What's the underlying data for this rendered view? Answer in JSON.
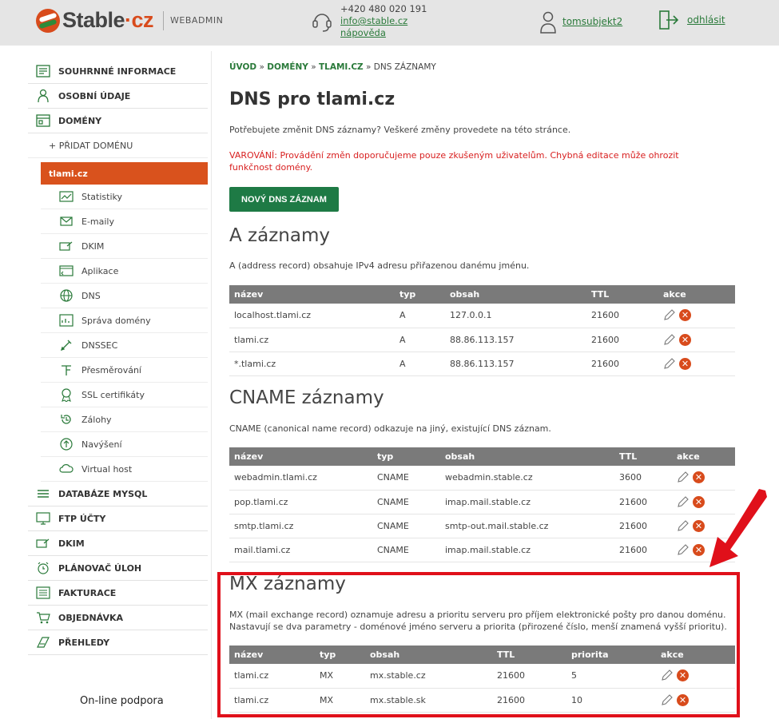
{
  "header": {
    "logo_text": "Stable",
    "logo_dot": "·cz",
    "logo_sub": "WEBADMIN",
    "phone": "+420 480 020 191",
    "email": "info@stable.cz",
    "help": "nápověda",
    "username": "tomsubjekt2",
    "logout": "odhlásit"
  },
  "sidebar": {
    "items_top": [
      {
        "label": "SOUHRNNÉ INFORMACE",
        "icon": "summary-icon"
      },
      {
        "label": "OSOBNÍ ÚDAJE",
        "icon": "person-icon"
      },
      {
        "label": "DOMÉNY",
        "icon": "domains-icon"
      }
    ],
    "add_domain": "+ PŘIDAT DOMÉNU",
    "active_domain": "tlami.cz",
    "sub_items": [
      {
        "label": "Statistiky",
        "icon": "stats-icon"
      },
      {
        "label": "E-maily",
        "icon": "email-icon"
      },
      {
        "label": "DKIM",
        "icon": "dkim-icon"
      },
      {
        "label": "Aplikace",
        "icon": "apps-icon"
      },
      {
        "label": "DNS",
        "icon": "globe-icon"
      },
      {
        "label": "Správa domény",
        "icon": "domain-manage-icon"
      },
      {
        "label": "DNSSEC",
        "icon": "dnssec-icon"
      },
      {
        "label": "Přesměrování",
        "icon": "redirect-icon"
      },
      {
        "label": "SSL certifikáty",
        "icon": "ssl-icon"
      },
      {
        "label": "Zálohy",
        "icon": "backup-icon"
      },
      {
        "label": "Navýšení",
        "icon": "upgrade-icon"
      },
      {
        "label": "Virtual host",
        "icon": "cloud-icon"
      }
    ],
    "items_bottom": [
      {
        "label": "DATABÁZE MYSQL",
        "icon": "database-icon"
      },
      {
        "label": "FTP ÚČTY",
        "icon": "ftp-icon"
      },
      {
        "label": "DKIM",
        "icon": "dkim-icon"
      },
      {
        "label": "PLÁNOVAČ ÚLOH",
        "icon": "alarm-icon"
      },
      {
        "label": "FAKTURACE",
        "icon": "invoice-icon"
      },
      {
        "label": "OBJEDNÁVKA",
        "icon": "cart-icon"
      },
      {
        "label": "PŘEHLEDY",
        "icon": "overview-icon"
      }
    ],
    "support": "On-line podpora"
  },
  "breadcrumb": {
    "home": "ÚVOD",
    "domains": "DOMÉNY",
    "domain": "TLAMI.CZ",
    "current": "DNS ZÁZNAMY"
  },
  "main": {
    "title": "DNS pro tlami.cz",
    "intro": "Potřebujete změnit DNS záznamy? Veškeré změny provedete na této stránce.",
    "warning": "VAROVÁNÍ: Provádění změn doporučujeme pouze zkušeným uživatelům. Chybná editace může ohrozit funkčnost domény.",
    "new_button": "NOVÝ DNS ZÁZNAM"
  },
  "a_section": {
    "title": "A záznamy",
    "desc": "A (address record) obsahuje IPv4 adresu přiřazenou danému jménu.",
    "headers": [
      "název",
      "typ",
      "obsah",
      "TTL",
      "akce"
    ],
    "rows": [
      [
        "localhost.tlami.cz",
        "A",
        "127.0.0.1",
        "21600"
      ],
      [
        "tlami.cz",
        "A",
        "88.86.113.157",
        "21600"
      ],
      [
        "*.tlami.cz",
        "A",
        "88.86.113.157",
        "21600"
      ]
    ]
  },
  "cname_section": {
    "title": "CNAME záznamy",
    "desc": "CNAME (canonical name record) odkazuje na jiný, existující DNS záznam.",
    "headers": [
      "název",
      "typ",
      "obsah",
      "TTL",
      "akce"
    ],
    "rows": [
      [
        "webadmin.tlami.cz",
        "CNAME",
        "webadmin.stable.cz",
        "3600"
      ],
      [
        "pop.tlami.cz",
        "CNAME",
        "imap.mail.stable.cz",
        "21600"
      ],
      [
        "smtp.tlami.cz",
        "CNAME",
        "smtp-out.mail.stable.cz",
        "21600"
      ],
      [
        "mail.tlami.cz",
        "CNAME",
        "imap.mail.stable.cz",
        "21600"
      ]
    ]
  },
  "mx_section": {
    "title": "MX záznamy",
    "desc_line1": "MX (mail exchange record) oznamuje adresu a prioritu serveru pro příjem elektronické pošty pro danou doménu.",
    "desc_line2": "Nastavují se dva parametry - doménové jméno serveru a priorita (přirozené číslo, menší znamená vyšší prioritu).",
    "headers": [
      "název",
      "typ",
      "obsah",
      "TTL",
      "priorita",
      "akce"
    ],
    "rows": [
      [
        "tlami.cz",
        "MX",
        "mx.stable.cz",
        "21600",
        "5"
      ],
      [
        "tlami.cz",
        "MX",
        "mx.stable.sk",
        "21600",
        "10"
      ]
    ]
  },
  "colors": {
    "accent_green": "#1e7a45",
    "accent_orange": "#d9521d",
    "highlight_red": "#e0101a"
  }
}
